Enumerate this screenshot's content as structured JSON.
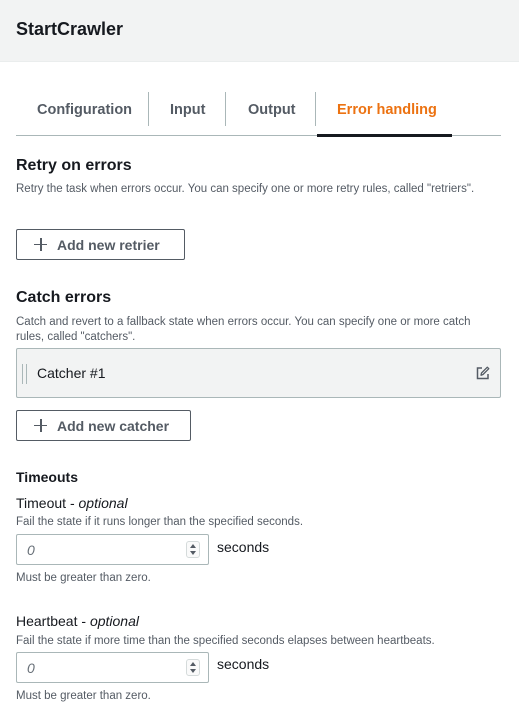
{
  "header": {
    "title": "StartCrawler"
  },
  "tabs": [
    {
      "label": "Configuration"
    },
    {
      "label": "Input"
    },
    {
      "label": "Output"
    },
    {
      "label": "Error handling",
      "active": true
    }
  ],
  "retry": {
    "title": "Retry on errors",
    "description": "Retry the task when errors occur. You can specify one or more retry rules, called \"retriers\".",
    "add_label": "Add new retrier"
  },
  "catch": {
    "title": "Catch errors",
    "description": "Catch and revert to a fallback state when errors occur. You can specify one or more catch rules, called \"catchers\".",
    "catchers": [
      {
        "label": "Catcher #1"
      }
    ],
    "add_label": "Add new catcher"
  },
  "timeouts": {
    "title": "Timeouts",
    "timeout": {
      "label": "Timeout",
      "optional": "optional",
      "description": "Fail the state if it runs longer than the specified seconds.",
      "placeholder": "0",
      "value": "",
      "unit": "seconds",
      "hint": "Must be greater than zero."
    },
    "heartbeat": {
      "label": "Heartbeat",
      "optional": "optional",
      "description": "Fail the state if more time than the specified seconds elapses between heartbeats.",
      "placeholder": "0",
      "value": "",
      "unit": "seconds",
      "hint": "Must be greater than zero."
    }
  },
  "icons": {
    "add": "plus-icon",
    "edit": "edit-icon",
    "drag": "drag-handle-icon",
    "spinner": "number-spinner-icon"
  },
  "colors": {
    "active_tab": "#ec7211",
    "header_bg": "#f2f3f3",
    "text": "#16191f",
    "muted": "#545b64"
  }
}
